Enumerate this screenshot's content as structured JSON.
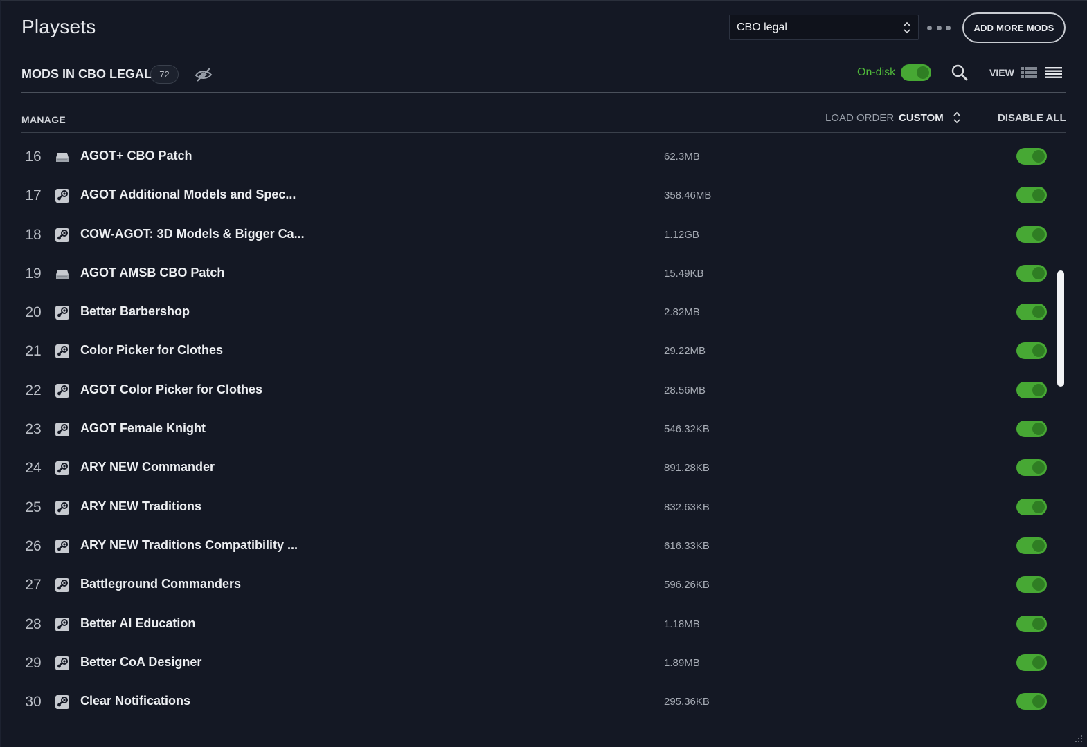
{
  "header": {
    "title": "Playsets",
    "playset_selected": "CBO legal",
    "add_more_mods_label": "ADD MORE MODS"
  },
  "subheader": {
    "mods_title": "MODS IN CBO LEGAL",
    "mod_count": "72",
    "ondisk_label": "On-disk",
    "view_label": "VIEW"
  },
  "list_header": {
    "manage_label": "MANAGE",
    "load_order_label": "LOAD ORDER",
    "load_order_value": "CUSTOM",
    "disable_all_label": "DISABLE ALL"
  },
  "colors": {
    "background": "#141824",
    "accent_green": "#47a834",
    "ondisk_text": "#4fb83a"
  },
  "mods": [
    {
      "num": "16",
      "source": "local-drive-icon",
      "name": "AGOT+ CBO Patch",
      "size": "62.3MB",
      "enabled": true
    },
    {
      "num": "17",
      "source": "steam-icon",
      "name": "AGOT Additional Models and Spec...",
      "size": "358.46MB",
      "enabled": true
    },
    {
      "num": "18",
      "source": "steam-icon",
      "name": "COW-AGOT: 3D Models & Bigger Ca...",
      "size": "1.12GB",
      "enabled": true
    },
    {
      "num": "19",
      "source": "local-drive-icon",
      "name": "AGOT AMSB CBO Patch",
      "size": "15.49KB",
      "enabled": true
    },
    {
      "num": "20",
      "source": "steam-icon",
      "name": "Better Barbershop",
      "size": "2.82MB",
      "enabled": true
    },
    {
      "num": "21",
      "source": "steam-icon",
      "name": "Color Picker for Clothes",
      "size": "29.22MB",
      "enabled": true
    },
    {
      "num": "22",
      "source": "steam-icon",
      "name": "AGOT Color Picker for Clothes",
      "size": "28.56MB",
      "enabled": true
    },
    {
      "num": "23",
      "source": "steam-icon",
      "name": "AGOT Female Knight",
      "size": "546.32KB",
      "enabled": true
    },
    {
      "num": "24",
      "source": "steam-icon",
      "name": "ARY NEW Commander",
      "size": "891.28KB",
      "enabled": true
    },
    {
      "num": "25",
      "source": "steam-icon",
      "name": "ARY NEW Traditions",
      "size": "832.63KB",
      "enabled": true
    },
    {
      "num": "26",
      "source": "steam-icon",
      "name": "ARY NEW Traditions Compatibility ...",
      "size": "616.33KB",
      "enabled": true
    },
    {
      "num": "27",
      "source": "steam-icon",
      "name": "Battleground Commanders",
      "size": "596.26KB",
      "enabled": true
    },
    {
      "num": "28",
      "source": "steam-icon",
      "name": "Better AI Education",
      "size": "1.18MB",
      "enabled": true
    },
    {
      "num": "29",
      "source": "steam-icon",
      "name": "Better CoA Designer",
      "size": "1.89MB",
      "enabled": true
    },
    {
      "num": "30",
      "source": "steam-icon",
      "name": "Clear Notifications",
      "size": "295.36KB",
      "enabled": true
    }
  ]
}
